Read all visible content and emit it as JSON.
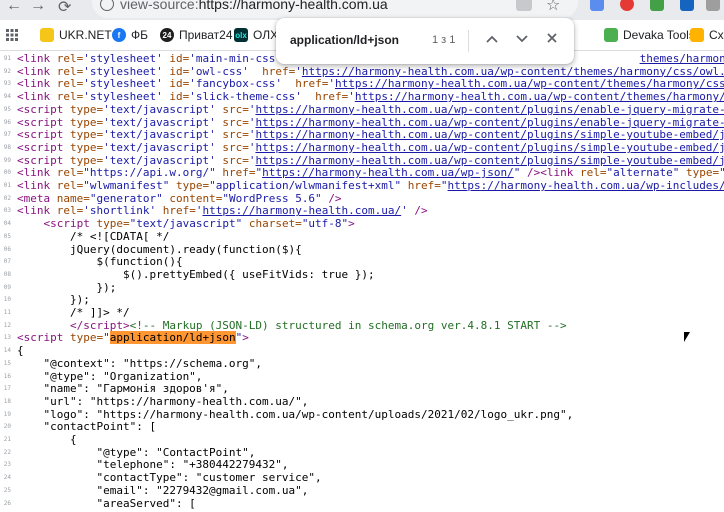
{
  "browser": {
    "url_scheme": "view-source:",
    "url_rest": "https://harmony-health.com.ua",
    "nav_back": "←",
    "nav_forward": "→"
  },
  "bookmarks": [
    {
      "label": "",
      "icon": "apps-icon"
    },
    {
      "label": "UKR.NET",
      "icon": "ukrnet-icon",
      "color": "#f5c518"
    },
    {
      "label": "ФБ",
      "icon": "facebook-icon",
      "color": "#1877f2"
    },
    {
      "label": "Приват24",
      "icon": "privat24-icon",
      "color": "#1f1f1f"
    },
    {
      "label": "ОЛХ",
      "icon": "olx-icon",
      "color": "#23e5db"
    },
    {
      "label": "Devaka Tools",
      "icon": "devaka-icon",
      "color": "#4caf50"
    },
    {
      "label": "Сх",
      "icon": "folder-icon",
      "color": "#6d6d6d"
    }
  ],
  "find": {
    "query": "application/ld+json",
    "count": "1 з 1",
    "prev": "⌃",
    "next": "⌄",
    "close": "✕"
  },
  "source_lines": [
    {
      "n": "91",
      "html": "<span class='tg'>&lt;link</span> <span class='an'>rel=</span><span class='av'>'stylesheet'</span> <span class='an'>id=</span><span class='av'>'main-min-css'</span>  <span class='an'>h</span>                                                   <span class='lk'>themes/harmony/media.css?ver</span>"
    },
    {
      "n": "92",
      "html": "<span class='tg'>&lt;link</span> <span class='an'>rel=</span><span class='av'>'stylesheet'</span> <span class='an'>id=</span><span class='av'>'owl-css'</span>  <span class='an'>href=</span><span class='av'>'</span><span class='lk'>https://harmony-health.com.ua/wp-content/themes/harmony/css/owl.carousel.m</span>"
    },
    {
      "n": "93",
      "html": "<span class='tg'>&lt;link</span> <span class='an'>rel=</span><span class='av'>'stylesheet'</span> <span class='an'>id=</span><span class='av'>'fancybox-css'</span>  <span class='an'>href=</span><span class='av'>'</span><span class='lk'>https://harmony-health.com.ua/wp-content/themes/harmony/css/jquery.fa</span>"
    },
    {
      "n": "94",
      "html": "<span class='tg'>&lt;link</span> <span class='an'>rel=</span><span class='av'>'stylesheet'</span> <span class='an'>id=</span><span class='av'>'slick-theme-css'</span>  <span class='an'>href=</span><span class='av'>'</span><span class='lk'>https://harmony-health.com.ua/wp-content/themes/harmony/css/slick-</span>"
    },
    {
      "n": "95",
      "html": "<span class='tg'>&lt;script</span> <span class='an'>type=</span><span class='av'>'text/javascript'</span> <span class='an'>src=</span><span class='av'>'</span><span class='lk'>https://harmony-health.com.ua/wp-content/plugins/enable-jquery-migrate-helper/js/</span>"
    },
    {
      "n": "96",
      "html": "<span class='tg'>&lt;script</span> <span class='an'>type=</span><span class='av'>'text/javascript'</span> <span class='an'>src=</span><span class='av'>'</span><span class='lk'>https://harmony-health.com.ua/wp-content/plugins/enable-jquery-migrate-helper/js/</span>"
    },
    {
      "n": "97",
      "html": "<span class='tg'>&lt;script</span> <span class='an'>type=</span><span class='av'>'text/javascript'</span> <span class='an'>src=</span><span class='av'>'</span><span class='lk'>https://harmony-health.com.ua/wp-content/plugins/simple-youtube-embed/jquery.wait</span>"
    },
    {
      "n": "98",
      "html": "<span class='tg'>&lt;script</span> <span class='an'>type=</span><span class='av'>'text/javascript'</span> <span class='an'>src=</span><span class='av'>'</span><span class='lk'>https://harmony-health.com.ua/wp-content/plugins/simple-youtube-embed/jquery.pret</span>"
    },
    {
      "n": "99",
      "html": "<span class='tg'>&lt;script</span> <span class='an'>type=</span><span class='av'>'text/javascript'</span> <span class='an'>src=</span><span class='av'>'</span><span class='lk'>https://harmony-health.com.ua/wp-content/plugins/simple-youtube-embed/jquery.fitv</span>"
    },
    {
      "n": "00",
      "html": "<span class='tg'>&lt;link</span> <span class='an'>rel=</span><span class='av'>\"https://api.w.org/\"</span> <span class='an'>href=</span><span class='av'>\"</span><span class='lk'>https://harmony-health.com.ua/wp-json/</span><span class='av'>\"</span> <span class='tg'>/&gt;&lt;link</span> <span class='an'>rel=</span><span class='av'>\"alternate\"</span> <span class='an'>type=</span><span class='av'>\"applicatio</span>"
    },
    {
      "n": "01",
      "html": "<span class='tg'>&lt;link</span> <span class='an'>rel=</span><span class='av'>\"wlwmanifest\"</span> <span class='an'>type=</span><span class='av'>\"application/wlwmanifest+xml\"</span> <span class='an'>href=</span><span class='av'>\"</span><span class='lk'>https://harmony-health.com.ua/wp-includes/wlwmanifest</span>"
    },
    {
      "n": "02",
      "html": "<span class='tg'>&lt;meta</span> <span class='an'>name=</span><span class='av'>\"generator\"</span> <span class='an'>content=</span><span class='av'>\"WordPress 5.6\"</span> <span class='tg'>/&gt;</span>"
    },
    {
      "n": "03",
      "html": "<span class='tg'>&lt;link</span> <span class='an'>rel=</span><span class='av'>'shortlink'</span> <span class='an'>href=</span><span class='av'>'</span><span class='lk'>https://harmony-health.com.ua/</span><span class='av'>'</span> <span class='tg'>/&gt;</span>"
    },
    {
      "n": "04",
      "html": "    <span class='tg'>&lt;script</span> <span class='an'>type=</span><span class='av'>\"text/javascript\"</span> <span class='an'>charset=</span><span class='av'>\"utf-8\"</span><span class='tg'>&gt;</span>"
    },
    {
      "n": "05",
      "html": "        /* &lt;![CDATA[ */"
    },
    {
      "n": "06",
      "html": "        jQuery(document).ready(function($){"
    },
    {
      "n": "07",
      "html": "            $(function(){"
    },
    {
      "n": "08",
      "html": "                $().prettyEmbed({ useFitVids: true });"
    },
    {
      "n": "09",
      "html": "            });"
    },
    {
      "n": "10",
      "html": "        });"
    },
    {
      "n": "11",
      "html": "        /* ]]&gt; */"
    },
    {
      "n": "12",
      "html": "        <span class='tg'>&lt;/script&gt;</span><span class='cm'>&lt;!-- Markup (JSON-LD) structured in schema.org ver.4.8.1 START --&gt;</span>"
    },
    {
      "n": "13",
      "html": "<span class='tg'>&lt;script</span> <span class='an'>type=</span><span class='av'>\"</span><span class='hl'>application/ld+json</span><span class='av'>\"</span><span class='tg'>&gt;</span>"
    },
    {
      "n": "14",
      "html": "{"
    },
    {
      "n": "15",
      "html": "    \"@context\": \"https://schema.org\","
    },
    {
      "n": "16",
      "html": "    \"@type\": \"Organization\","
    },
    {
      "n": "17",
      "html": "    \"name\": \"Гармонія здоров'я\","
    },
    {
      "n": "18",
      "html": "    \"url\": \"https://harmony-health.com.ua/\","
    },
    {
      "n": "19",
      "html": "    \"logo\": \"https://harmony-health.com.ua/wp-content/uploads/2021/02/logo_ukr.png\","
    },
    {
      "n": "20",
      "html": "    \"contactPoint\": ["
    },
    {
      "n": "21",
      "html": "        {"
    },
    {
      "n": "22",
      "html": "            \"@type\": \"ContactPoint\","
    },
    {
      "n": "23",
      "html": "            \"telephone\": \"+380442279432\","
    },
    {
      "n": "24",
      "html": "            \"contactType\": \"customer service\","
    },
    {
      "n": "25",
      "html": "            \"email\": \"2279432@gmail.com.ua\","
    },
    {
      "n": "26",
      "html": "            \"areaServed\": ["
    }
  ]
}
